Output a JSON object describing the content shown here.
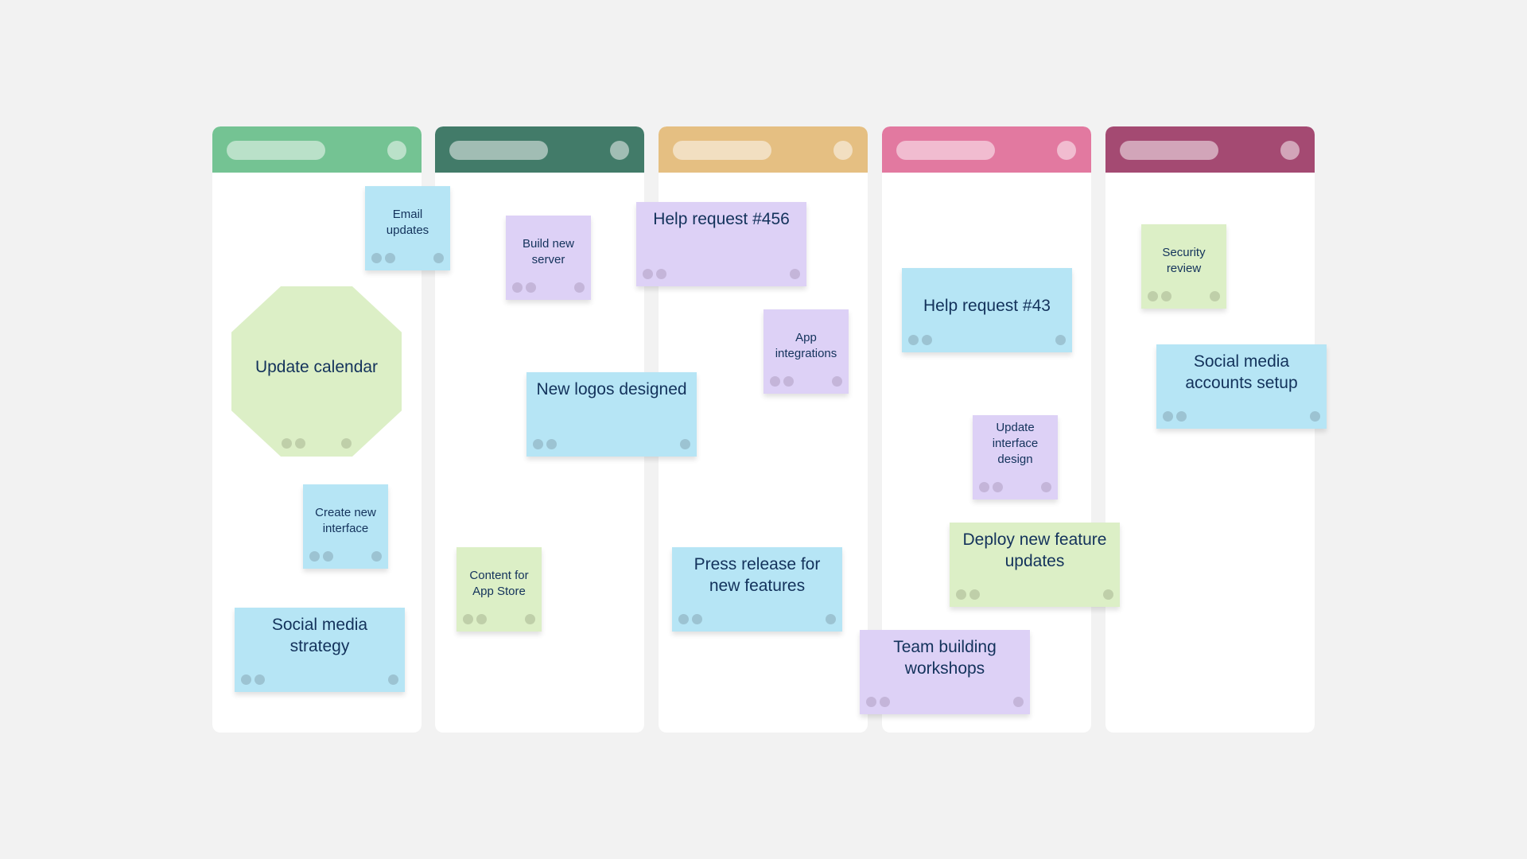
{
  "board": {
    "columns": [
      {
        "id": "col-1",
        "header_color": "#74c393"
      },
      {
        "id": "col-2",
        "header_color": "#427b69"
      },
      {
        "id": "col-3",
        "header_color": "#e5bf82"
      },
      {
        "id": "col-4",
        "header_color": "#e279a0"
      },
      {
        "id": "col-5",
        "header_color": "#a44a72"
      }
    ],
    "note_colors": {
      "blue": "#b6e5f5",
      "purple": "#ddd1f6",
      "green": "#dcefc6"
    },
    "notes": [
      {
        "text": "Email updates",
        "color": "blue",
        "column": 1
      },
      {
        "text": "Update calendar",
        "color": "green",
        "shape": "octagon",
        "column": 1
      },
      {
        "text": "Create new interface",
        "color": "blue",
        "column": 1
      },
      {
        "text": "Social media strategy",
        "color": "blue",
        "column": 1
      },
      {
        "text": "Build new server",
        "color": "purple",
        "column": 2
      },
      {
        "text": "New logos designed",
        "color": "blue",
        "column": 2
      },
      {
        "text": "Content for App Store",
        "color": "green",
        "column": 2
      },
      {
        "text": "Help request #456",
        "color": "purple",
        "column": 3
      },
      {
        "text": "App integrations",
        "color": "purple",
        "column": 3
      },
      {
        "text": "Press release for new features",
        "color": "blue",
        "column": 3
      },
      {
        "text": "Help request #43",
        "color": "blue",
        "column": 4
      },
      {
        "text": "Update interface design",
        "color": "purple",
        "column": 4
      },
      {
        "text": "Deploy new feature updates",
        "color": "green",
        "column": 4
      },
      {
        "text": "Team building workshops",
        "color": "purple",
        "column": 4
      },
      {
        "text": "Security review",
        "color": "green",
        "column": 5
      },
      {
        "text": "Social media accounts setup",
        "color": "blue",
        "column": 5
      }
    ]
  }
}
